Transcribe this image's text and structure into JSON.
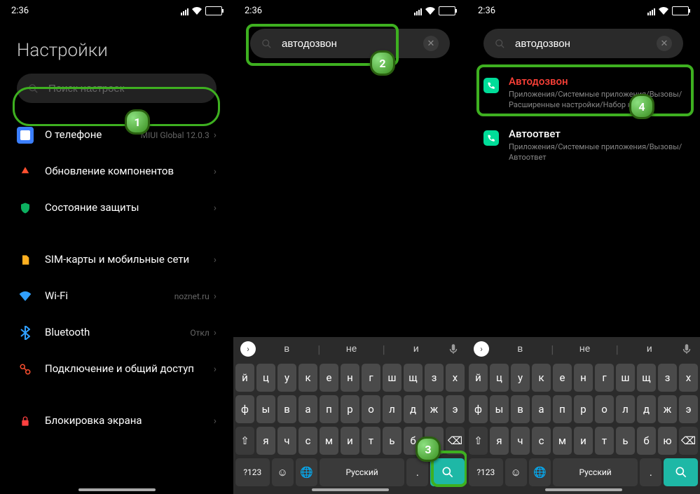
{
  "statusBar": {
    "time": "2:36"
  },
  "p1": {
    "title": "Настройки",
    "searchPlaceholder": "Поиск настроек",
    "items": [
      {
        "label": "О телефоне",
        "sub": "MIUI Global 12.0.3",
        "icon": "#3b7fff"
      },
      {
        "label": "Обновление компонентов",
        "icon": "#ff5030"
      },
      {
        "label": "Состояние защиты",
        "icon": "#0cb060"
      },
      {
        "sep": true
      },
      {
        "label": "SIM-карты и мобильные сети",
        "icon": "#ffb020"
      },
      {
        "label": "Wi-Fi",
        "sub": "noznet.ru",
        "icon": "#30a0ff"
      },
      {
        "label": "Bluetooth",
        "sub": "Откл",
        "icon": "#30a0ff"
      },
      {
        "label": "Подключение и общий доступ",
        "icon": "#ff5030"
      },
      {
        "sep": true
      },
      {
        "label": "Блокировка экрана",
        "icon": "#ff4040"
      }
    ]
  },
  "p2": {
    "searchValue": "автодозвон",
    "sug": [
      "в",
      "не",
      "и"
    ]
  },
  "p3": {
    "searchValue": "автодозвон",
    "results": [
      {
        "title": "Автодозвон",
        "path": "Приложения/Системные приложения/Вызовы/Расширенные настройки/Набор номера",
        "hl": true
      },
      {
        "title": "Автоответ",
        "path": "Приложения/Системные приложения/Вызовы/Автоответ"
      }
    ]
  },
  "kb": {
    "r1": [
      "й",
      "ц",
      "у",
      "к",
      "е",
      "н",
      "г",
      "ш",
      "щ",
      "з",
      "х"
    ],
    "r2": [
      "ф",
      "ы",
      "в",
      "а",
      "п",
      "р",
      "о",
      "л",
      "д",
      "ж",
      "э"
    ],
    "r3": [
      "я",
      "ч",
      "с",
      "м",
      "и",
      "т",
      "ь",
      "б",
      "ю"
    ],
    "shift": "⇧",
    "bksp": "⌫",
    "num": "?123",
    "emoji": "☺",
    "globe": "🌐",
    "lang": "Русский",
    "dot": ".",
    "search": "🔍"
  },
  "badges": {
    "b1": "1",
    "b2": "2",
    "b3": "3",
    "b4": "4"
  }
}
